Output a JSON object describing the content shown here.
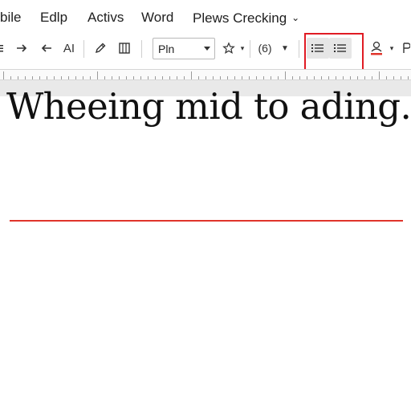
{
  "menu": {
    "items": [
      "bile",
      "Edlp",
      "Activs",
      "Word",
      "Plews Crecking"
    ]
  },
  "toolbar": {
    "ai_label": "AI",
    "font_value": "Pln",
    "counter_label": "(6)"
  },
  "document": {
    "text": "Wheeing mid to ading."
  },
  "colors": {
    "highlight_box": "#e01b24",
    "spell_underline": "#e0342b"
  }
}
